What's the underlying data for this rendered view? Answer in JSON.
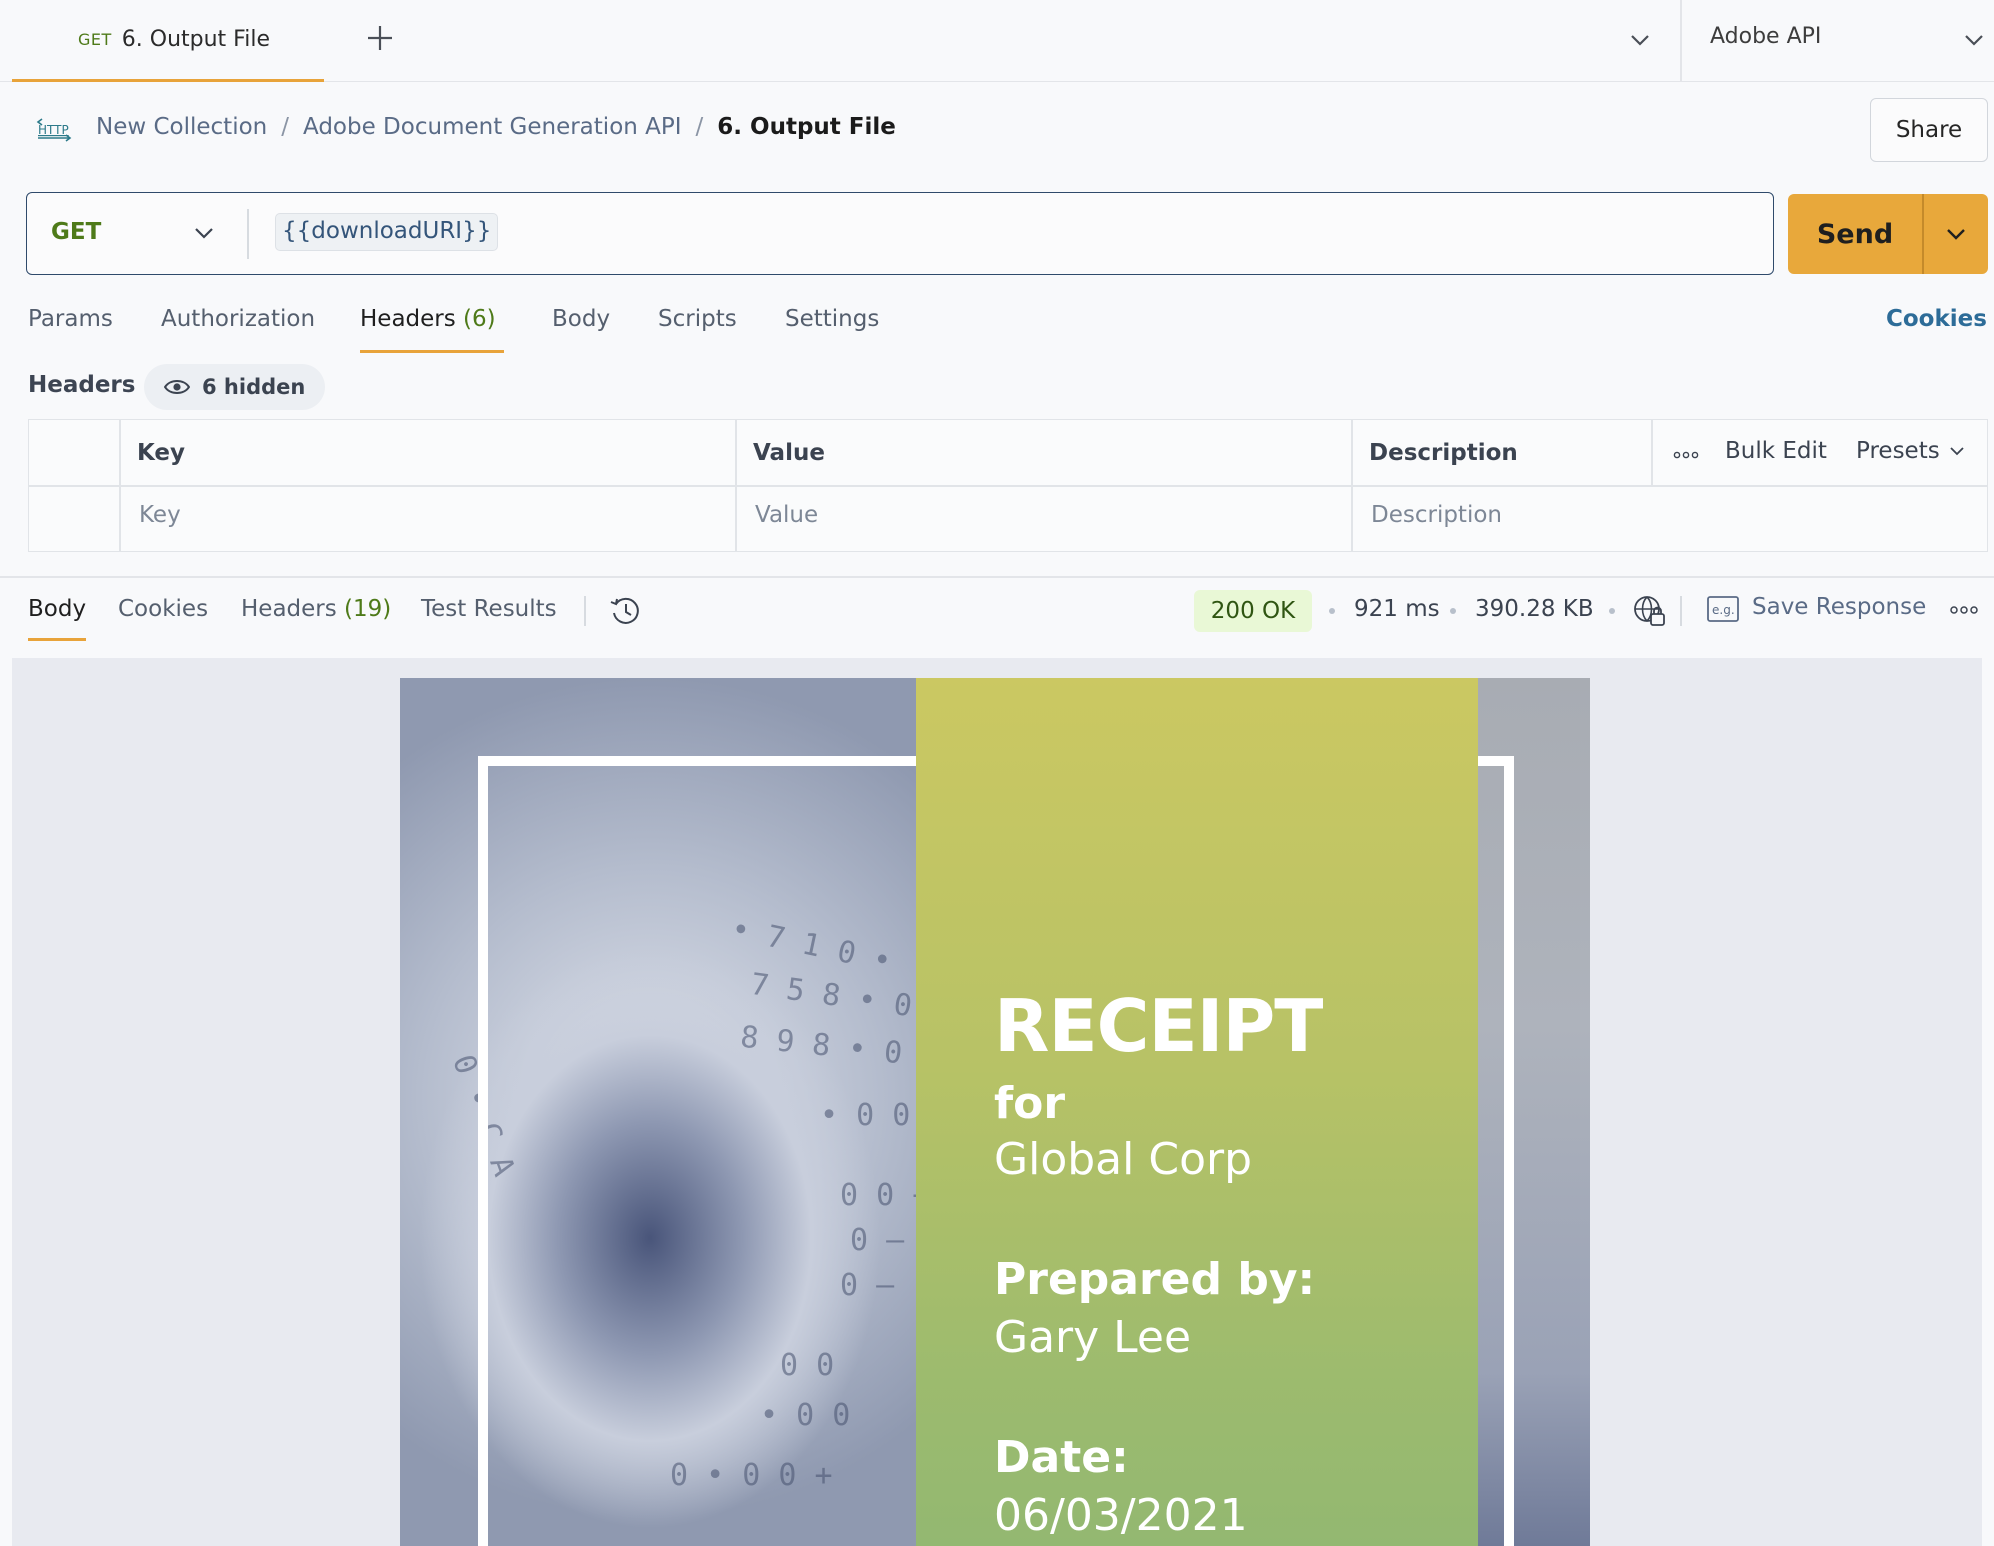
{
  "tabs": [
    {
      "method": "GET",
      "title": "6. Output File",
      "active": true
    }
  ],
  "new_tab_icon": "plus-icon",
  "environment": {
    "label": "Adobe API"
  },
  "breadcrumb": {
    "icon": "http-icon",
    "items": [
      "New Collection",
      "Adobe Document Generation API"
    ],
    "current": "6. Output File",
    "separator": "/"
  },
  "share_label": "Share",
  "request": {
    "method": "GET",
    "url": "{{downloadURI}}",
    "send_label": "Send"
  },
  "request_tabs": [
    {
      "label": "Params"
    },
    {
      "label": "Authorization"
    },
    {
      "label": "Headers",
      "count": "(6)",
      "active": true
    },
    {
      "label": "Body"
    },
    {
      "label": "Scripts"
    },
    {
      "label": "Settings"
    }
  ],
  "cookies_link": "Cookies",
  "headers": {
    "title": "Headers",
    "hidden_label": "6 hidden",
    "columns": [
      "Key",
      "Value",
      "Description"
    ],
    "bulk_edit": "Bulk Edit",
    "presets": "Presets",
    "placeholders": {
      "key": "Key",
      "value": "Value",
      "description": "Description"
    }
  },
  "response": {
    "tabs": [
      {
        "label": "Body",
        "active": true
      },
      {
        "label": "Cookies"
      },
      {
        "label": "Headers",
        "count": "(19)"
      },
      {
        "label": "Test Results"
      }
    ],
    "status": "200 OK",
    "time": "921 ms",
    "size": "390.28 KB",
    "save_label": "Save Response"
  },
  "document": {
    "title": "RECEIPT",
    "for_label": "for",
    "company": "Global Corp",
    "prepared_label": "Prepared by:",
    "prepared_name": "Gary Lee",
    "date_label": "Date:",
    "date_value": "06/03/2021"
  },
  "colors": {
    "accent": "#e8a33a",
    "get_method": "#4e7a19",
    "send_button": "#e8a83b",
    "status_ok_bg": "#e9f8d6",
    "link": "#2d6c98",
    "receipt_panel": "#b7c266"
  }
}
